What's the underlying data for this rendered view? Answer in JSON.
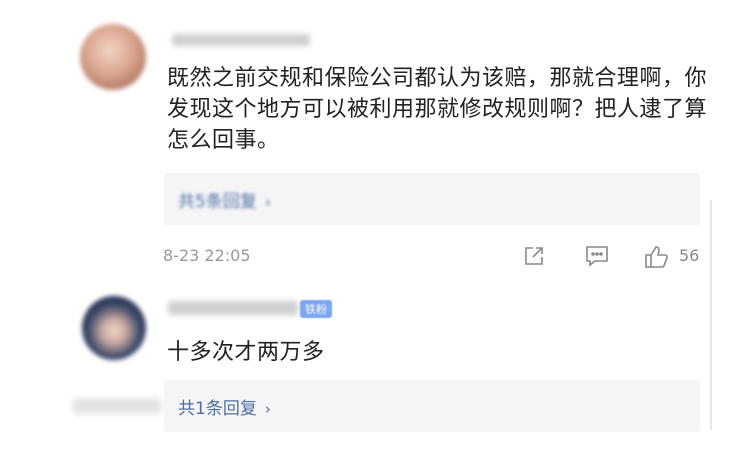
{
  "comments": [
    {
      "text": "既然之前交规和保险公司都认为该赔，那就合理啊，你发现这个地方可以被利用那就修改规则啊？把人逮了算怎么回事。",
      "replies_label": "共5条回复",
      "timestamp": "8-23 22:05",
      "like_count": "56",
      "actions": [
        "share-icon",
        "comment-icon",
        "like-icon"
      ]
    },
    {
      "text": "十多次才两万多",
      "fan_badge": "铁粉",
      "replies_label": "共1条回复"
    }
  ],
  "colors": {
    "text": "#222222",
    "link": "#4a6fa5",
    "meta": "#999999",
    "reply_bg": "#f5f5f6"
  }
}
